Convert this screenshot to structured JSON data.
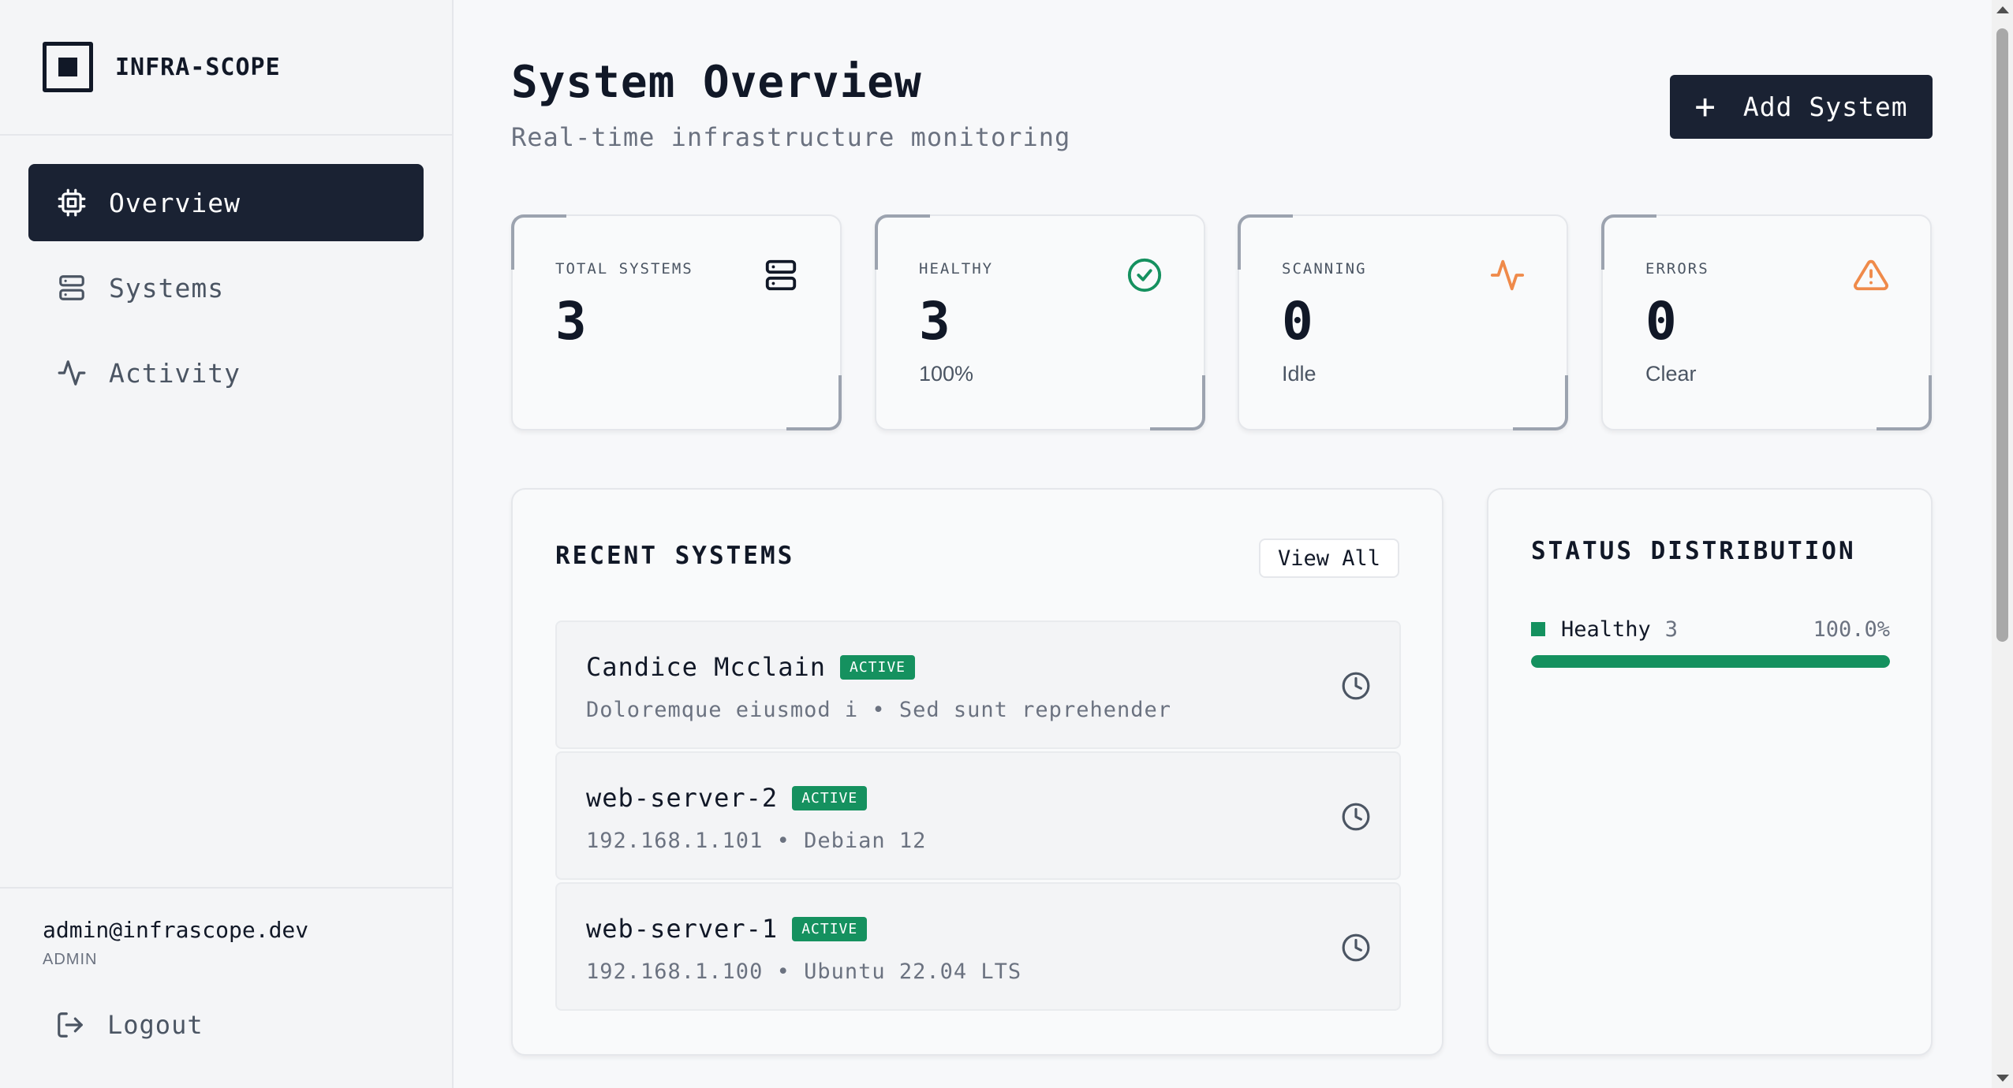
{
  "brand": {
    "name": "INFRA-SCOPE"
  },
  "nav": [
    {
      "label": "Overview",
      "icon": "cpu-icon",
      "active": true
    },
    {
      "label": "Systems",
      "icon": "server-icon",
      "active": false
    },
    {
      "label": "Activity",
      "icon": "activity-icon",
      "active": false
    }
  ],
  "user": {
    "email": "admin@infrascope.dev",
    "role": "ADMIN",
    "logout_label": "Logout"
  },
  "header": {
    "title": "System Overview",
    "subtitle": "Real-time infrastructure monitoring",
    "add_button_label": "Add System"
  },
  "stats": [
    {
      "label": "TOTAL SYSTEMS",
      "value": "3",
      "sub": "",
      "icon": "server-icon",
      "color": "#111827"
    },
    {
      "label": "HEALTHY",
      "value": "3",
      "sub": "100%",
      "icon": "check-circle-icon",
      "color": "#15915f"
    },
    {
      "label": "SCANNING",
      "value": "0",
      "sub": "Idle",
      "icon": "activity-icon",
      "color": "#ef8a4a"
    },
    {
      "label": "ERRORS",
      "value": "0",
      "sub": "Clear",
      "icon": "alert-triangle-icon",
      "color": "#ef8a4a"
    }
  ],
  "recent": {
    "title": "RECENT SYSTEMS",
    "view_all_label": "View All",
    "items": [
      {
        "name": "Candice Mcclain",
        "status": "ACTIVE",
        "meta": "Doloremque eiusmod i • Sed sunt reprehender"
      },
      {
        "name": "web-server-2",
        "status": "ACTIVE",
        "meta": "192.168.1.101 • Debian 12"
      },
      {
        "name": "web-server-1",
        "status": "ACTIVE",
        "meta": "192.168.1.100 • Ubuntu 22.04 LTS"
      }
    ]
  },
  "distribution": {
    "title": "STATUS DISTRIBUTION",
    "rows": [
      {
        "label": "Healthy",
        "count": "3",
        "percent": "100.0%",
        "fraction": 1.0,
        "color": "#15915f"
      }
    ]
  }
}
